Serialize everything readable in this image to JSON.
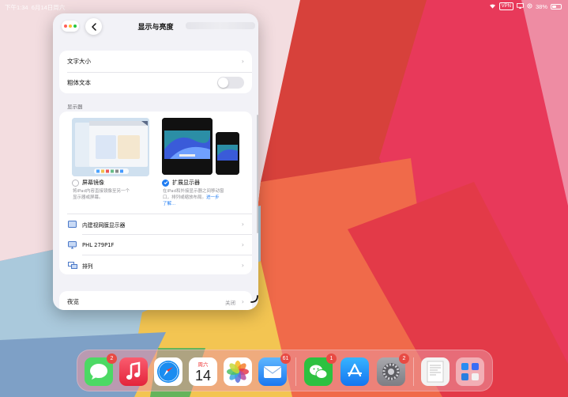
{
  "statusbar": {
    "time": "下午1:34",
    "date": "6月14日周六",
    "vpn": "VPN",
    "battery": "38%"
  },
  "window": {
    "title": "显示与亮度",
    "rows": [
      {
        "label": "文字大小"
      },
      {
        "label": "粗体文本",
        "toggle_on": false
      }
    ],
    "display_section": "显示器",
    "options": [
      {
        "label": "屏幕镜像",
        "selected": false,
        "desc_line1": "将iPad内容直接镜像至另一个",
        "desc_line2": "显示器或屏幕。"
      },
      {
        "label": "扩展显示器",
        "selected": true,
        "desc_line1": "在iPad和外接显示器之间移动窗",
        "desc_line2": "口，排列或缩放布局。",
        "learn_more": "进一步",
        "learn_more2": "了解…"
      }
    ],
    "display_rows": [
      {
        "label": "内建视网膜显示器",
        "icon": "ipad-display-icon"
      },
      {
        "label": "PHL 279P1F",
        "icon": "monitor-icon"
      },
      {
        "label": "排列",
        "icon": "arrange-displays-icon"
      }
    ],
    "night_shift": {
      "label": "夜览",
      "value": "关闭"
    }
  },
  "dock": {
    "apps": [
      {
        "name": "messages-app-icon",
        "badge": "2"
      },
      {
        "name": "music-app-icon",
        "badge": ""
      },
      {
        "name": "safari-app-icon",
        "badge": ""
      },
      {
        "name": "calendar-app-icon",
        "badge": "",
        "weekday": "周六",
        "day": "14"
      },
      {
        "name": "photos-app-icon",
        "badge": ""
      },
      {
        "name": "mail-app-icon",
        "badge": "61"
      },
      {
        "name": "wechat-app-icon",
        "badge": "1"
      },
      {
        "name": "app-store-app-icon",
        "badge": ""
      },
      {
        "name": "settings-app-icon",
        "badge": "2"
      },
      {
        "name": "document-app-icon",
        "badge": ""
      },
      {
        "name": "app-library-icon",
        "badge": ""
      }
    ]
  },
  "colors": {
    "accent": "#1f7cf2",
    "badge": "#e84a43"
  }
}
